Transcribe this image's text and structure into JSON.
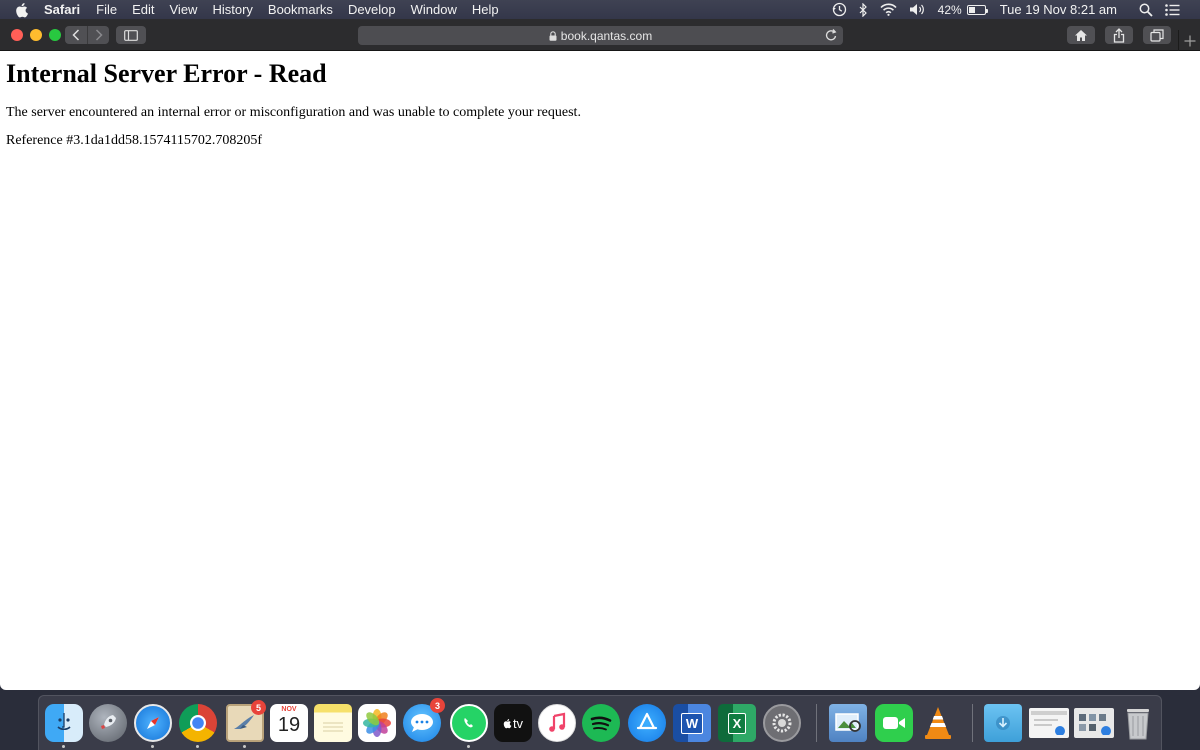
{
  "menubar": {
    "app_name": "Safari",
    "items": [
      "File",
      "Edit",
      "View",
      "History",
      "Bookmarks",
      "Develop",
      "Window",
      "Help"
    ],
    "battery_percent": "42%",
    "battery_level": 0.42,
    "clock": "Tue 19 Nov  8:21 am"
  },
  "toolbar": {
    "url": "book.qantas.com"
  },
  "page": {
    "title": "Internal Server Error - Read",
    "message": "The server encountered an internal error or misconfiguration and was unable to complete your request.",
    "reference": "Reference #3.1da1dd58.1574115702.708205f"
  },
  "dock": {
    "mail_badge": "5",
    "calendar_month": "NOV",
    "calendar_day": "19",
    "messages_badge": "3",
    "tv_label": "tv",
    "word_letter": "W",
    "excel_letter": "X"
  }
}
